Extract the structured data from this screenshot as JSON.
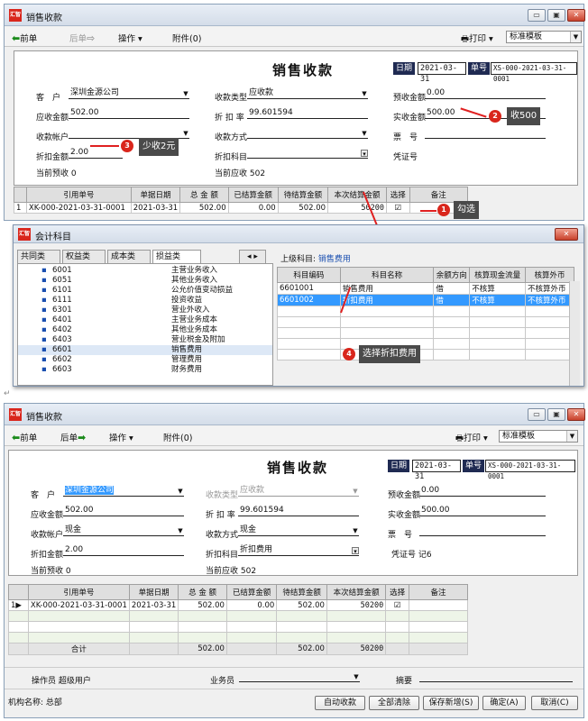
{
  "window": {
    "title": "销售收款",
    "logo": "汇智",
    "min": "▭",
    "max": "▣",
    "close": "✕"
  },
  "toolbar": {
    "prev": "前单",
    "next": "后单",
    "operate": "操作",
    "attach": "附件(0)",
    "print": "打印",
    "template": "标准模板"
  },
  "form": {
    "title": "销售收款",
    "date_label": "日期",
    "date": "2021-03-31",
    "doc_label": "单号",
    "doc_no": "XS-000-2021-03-31-0001",
    "customer_label": "客　户",
    "customer": "深圳金源公司",
    "collect_type_label": "收款类型",
    "collect_type": "应收款",
    "prepaid_label": "预收金额",
    "prepaid": "0.00",
    "receivable_label": "应收金额",
    "receivable": "502.00",
    "discount_rate_label": "折 扣 率",
    "discount_rate": "99.601594",
    "actual_label": "实收金额",
    "actual": "500.00",
    "account_label": "收款帐户",
    "account_after": "现金",
    "method_label": "收款方式",
    "method_after": "现金",
    "ticket_label": "票　号",
    "discount_amt_label": "折扣金额",
    "discount_amt": "2.00",
    "discount_subj_label": "折扣科目",
    "discount_subj_after": "折扣费用",
    "voucher_label": "凭证号",
    "voucher_after": "记6",
    "cur_prepaid_label": "当前预收",
    "cur_prepaid": "0",
    "cur_recv_label": "当前应收",
    "cur_recv": "502"
  },
  "grid": {
    "headers": [
      "引用单号",
      "单据日期",
      "总 金 额",
      "已结算金额",
      "待结算金额",
      "本次结算金额",
      "选择",
      "备注"
    ],
    "row": {
      "idx": "1",
      "ref": "XK-000-2021-03-31-0001",
      "date": "2021-03-31",
      "total": "502.00",
      "settled": "0.00",
      "pending": "502.00",
      "current": "50200",
      "check": "☑"
    },
    "total_label": "合计",
    "total_total": "502.00",
    "total_pending": "502.00",
    "total_current": "50200"
  },
  "annotations": {
    "n1": "1",
    "t1": "勾选",
    "n2": "2",
    "t2": "收500",
    "n3": "3",
    "t3": "少收2元",
    "n4": "4",
    "t4": "选择折扣费用"
  },
  "dialog": {
    "title": "会计科目",
    "tabs": [
      "共同类",
      "权益类",
      "成本类",
      "损益类"
    ],
    "parent_label": "上级科目:",
    "parent": "销售费用",
    "codes": [
      "6001",
      "6051",
      "6101",
      "6111",
      "6301",
      "6401",
      "6402",
      "6403",
      "6601",
      "6602",
      "6603"
    ],
    "names": [
      "主营业务收入",
      "其他业务收入",
      "公允价值变动损益",
      "投资收益",
      "营业外收入",
      "主营业务成本",
      "其他业务成本",
      "营业税金及附加",
      "销售费用",
      "管理费用",
      "财务费用"
    ],
    "cols": [
      "科目编码",
      "科目名称",
      "余额方向",
      "核算现金流量",
      "核算外币"
    ],
    "rows": [
      {
        "code": "6601001",
        "name": "销售费用",
        "dir": "借",
        "cash": "不核算",
        "fx": "不核算外币"
      },
      {
        "code": "6601002",
        "name": "折扣费用",
        "dir": "借",
        "cash": "不核算",
        "fx": "不核算外币"
      }
    ]
  },
  "bottom": {
    "operator_label": "操作员",
    "operator": "超级用户",
    "salesman_label": "业务员",
    "summary_label": "摘要",
    "org_label": "机构名称:",
    "org": "总部",
    "buttons": [
      "自动收款",
      "全部清除",
      "保存新增(S)",
      "确定(A)",
      "取消(C)"
    ]
  },
  "colors": {
    "accent": "#d9261c",
    "tag": "#1f2a52",
    "selected": "#3399ff"
  }
}
